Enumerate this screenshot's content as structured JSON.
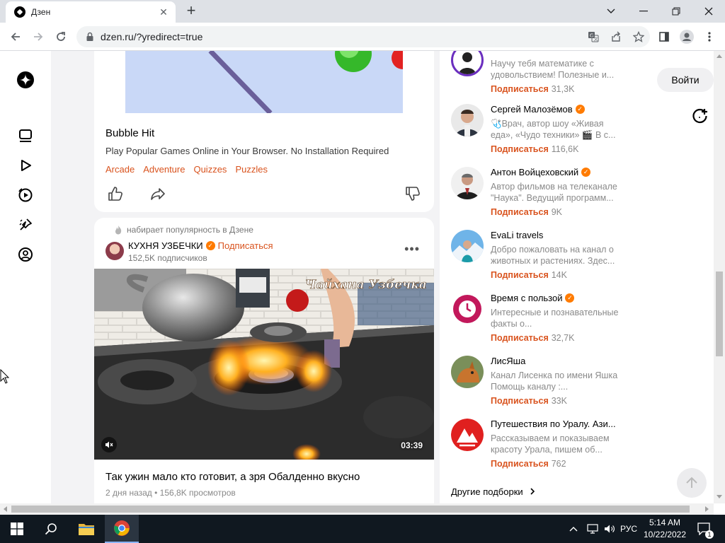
{
  "browser": {
    "tab_title": "Дзен",
    "url": "dzen.ru/?yredirect=true"
  },
  "header": {
    "login_label": "Войти"
  },
  "card1": {
    "title": "Bubble Hit",
    "description": "Play Popular Games Online in Your Browser. No Installation Required",
    "tags": [
      "Arcade",
      "Adventure",
      "Quizzes",
      "Puzzles"
    ]
  },
  "card2": {
    "trend_label": "набирает популярность в Дзене",
    "channel_name": "КУХНЯ УЗБЕЧКИ",
    "subscribe_label": "Подписаться",
    "subscribers": "152,5K подписчиков",
    "video_watermark": "Чайхана Узбечка",
    "duration": "03:39",
    "title": "Так ужин мало кто готовит, а зря Обалденно вкусно",
    "meta": "2 дня назад • 156,8K просмотров"
  },
  "channels": [
    {
      "name": "",
      "description": "Научу тебя математике с удовольствием! Полезные и...",
      "subscribe": "Подписаться",
      "count": "31,3K",
      "verified": false
    },
    {
      "name": "Сергей Малозёмов",
      "description": "🩺Врач, автор шоу «Живая еда», «Чудо техники» 🎬 В с...",
      "subscribe": "Подписаться",
      "count": "116,6K",
      "verified": true
    },
    {
      "name": "Антон Войцеховский",
      "description": "Автор фильмов на телеканале \"Наука\". Ведущий программ...",
      "subscribe": "Подписаться",
      "count": "9K",
      "verified": true
    },
    {
      "name": "EvaLi travels",
      "description": "Добро пожаловать на канал о животных и растениях. Здес...",
      "subscribe": "Подписаться",
      "count": "14K",
      "verified": false
    },
    {
      "name": "Время с пользой",
      "description": "Интересные и познавательные факты о...",
      "subscribe": "Подписаться",
      "count": "32,7K",
      "verified": true
    },
    {
      "name": "ЛисЯша",
      "description": "Канал Лисенка по имени Яшка Помощь каналу :...",
      "subscribe": "Подписаться",
      "count": "33K",
      "verified": false
    },
    {
      "name": "Путешествия по Уралу. Ази...",
      "description": "Рассказываем и показываем красоту Урала, пишем об...",
      "subscribe": "Подписаться",
      "count": "762",
      "verified": false
    }
  ],
  "other_collections": "Другие подборки",
  "taskbar": {
    "lang": "РУС",
    "time": "5:14 AM",
    "date": "10/22/2022",
    "notifications": "1"
  },
  "colors": {
    "accent": "#d9531e",
    "verified": "#ff7b00",
    "taskbar": "#101820"
  }
}
